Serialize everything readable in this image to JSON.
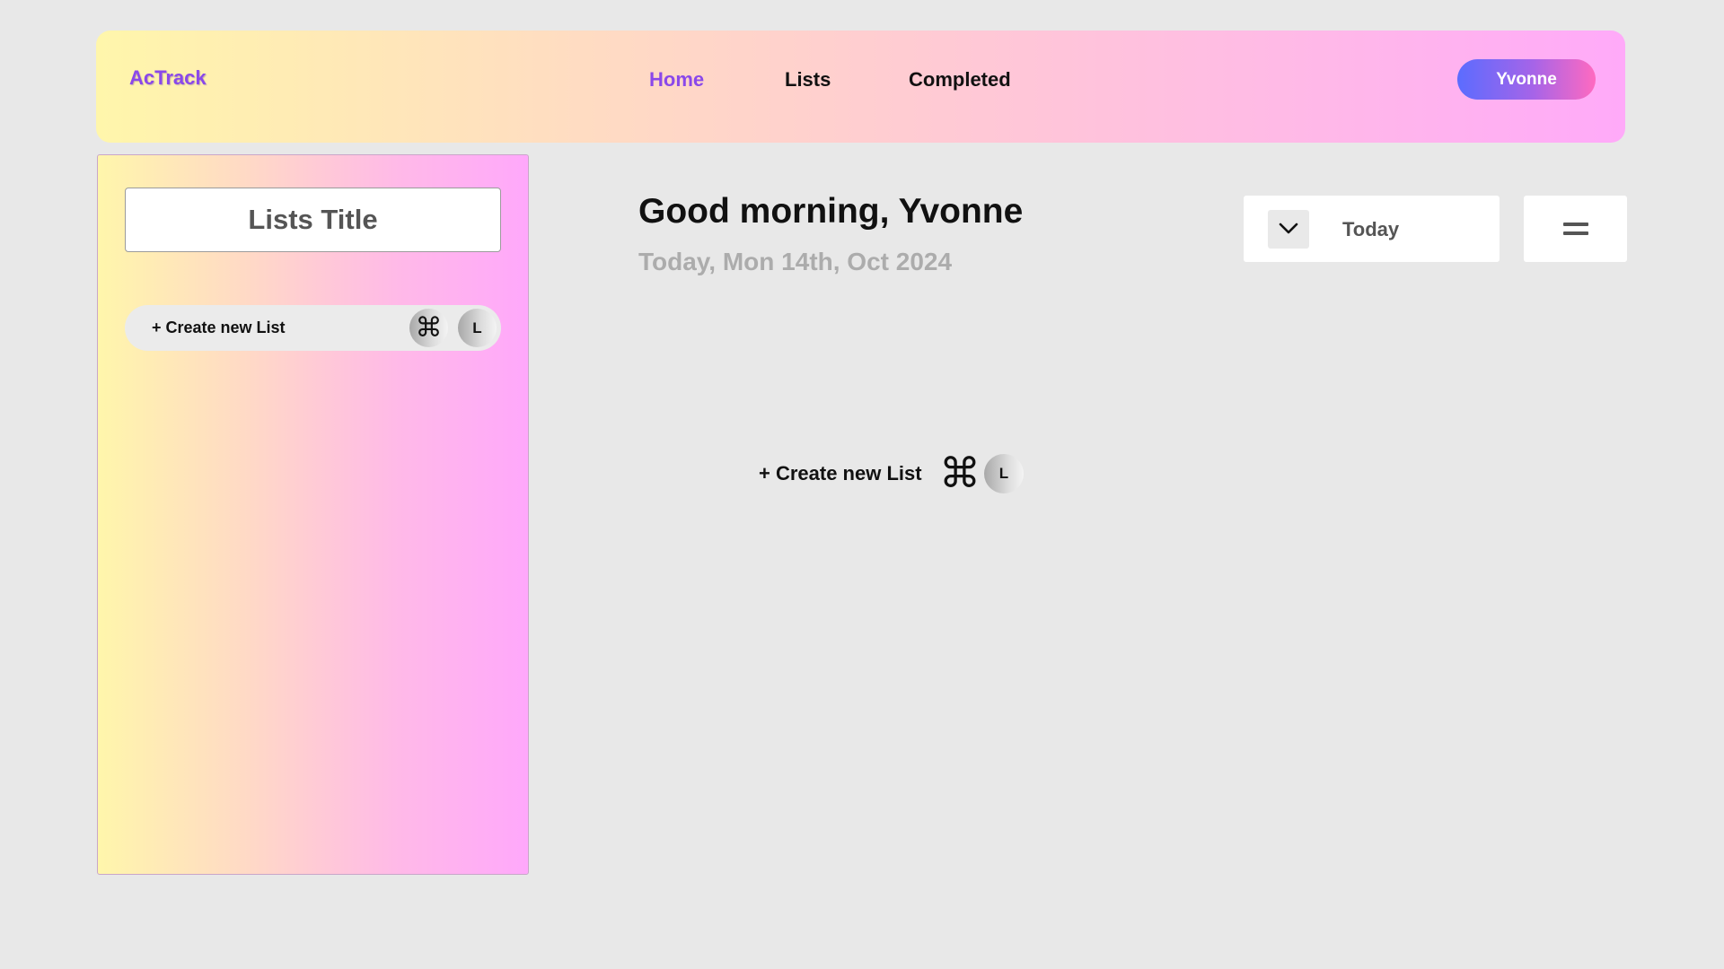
{
  "header": {
    "brand": "AcTrack",
    "nav": [
      {
        "label": "Home",
        "active": true
      },
      {
        "label": "Lists",
        "active": false
      },
      {
        "label": "Completed",
        "active": false
      }
    ],
    "user": "Yvonne"
  },
  "sidebar": {
    "title": "Lists Title",
    "create_label": "+ Create new List",
    "shortcut_cmd": "⌘",
    "shortcut_key": "L"
  },
  "main": {
    "greeting": "Good morning, Yvonne",
    "date": "Today, Mon 14th, Oct 2024",
    "filter_label": "Today",
    "create_label": "+ Create new List",
    "shortcut_cmd": "⌘",
    "shortcut_key": "L"
  },
  "icons": {
    "filter_toggle": "chevron-down-icon",
    "menu": "menu-lines-icon",
    "shortcut": "command-icon"
  },
  "colors": {
    "accent": "#8a48ea",
    "background": "#e8e8e8",
    "muted_text": "#acacac"
  }
}
